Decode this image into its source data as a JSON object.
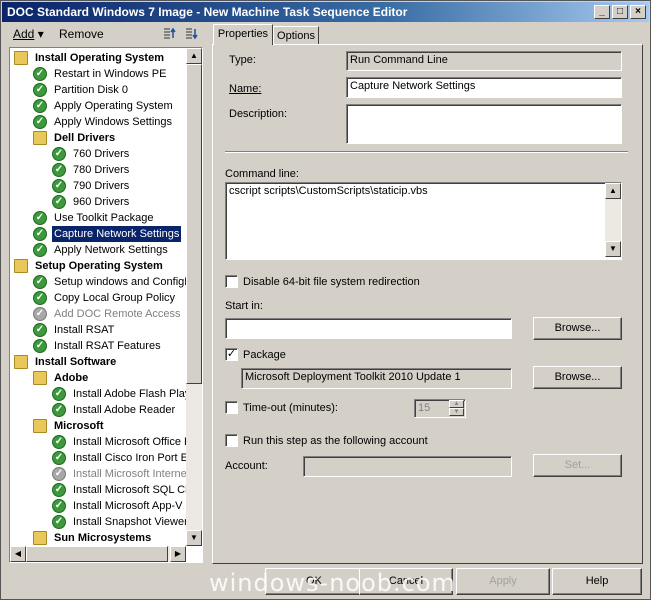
{
  "window": {
    "title": "DOC Standard Windows 7 Image - New Machine Task Sequence Editor",
    "min": "_",
    "max": "□",
    "close": "×"
  },
  "toolbar": {
    "add_label": "Add",
    "add_arrow": "▾",
    "remove_label": "Remove"
  },
  "tree": {
    "nodes": [
      {
        "label": "Install Operating System",
        "type": "group"
      },
      {
        "label": "Restart in Windows PE",
        "type": "step"
      },
      {
        "label": "Partition Disk 0",
        "type": "step"
      },
      {
        "label": "Apply Operating System",
        "type": "step"
      },
      {
        "label": "Apply Windows Settings",
        "type": "step"
      },
      {
        "label": "Dell Drivers",
        "type": "group"
      },
      {
        "label": "760 Drivers",
        "type": "step"
      },
      {
        "label": "780 Drivers",
        "type": "step"
      },
      {
        "label": "790 Drivers",
        "type": "step"
      },
      {
        "label": "960 Drivers",
        "type": "step"
      },
      {
        "label": "Use Toolkit Package",
        "type": "step"
      },
      {
        "label": "Capture Network Settings",
        "type": "step",
        "selected": true
      },
      {
        "label": "Apply Network Settings",
        "type": "step"
      },
      {
        "label": "Setup Operating System",
        "type": "group"
      },
      {
        "label": "Setup windows and ConfigM",
        "type": "step"
      },
      {
        "label": "Copy Local Group Policy",
        "type": "step"
      },
      {
        "label": "Add DOC Remote Access",
        "type": "step",
        "disabled": true
      },
      {
        "label": "Install RSAT",
        "type": "step"
      },
      {
        "label": "Install RSAT Features",
        "type": "step"
      },
      {
        "label": "Install Software",
        "type": "group"
      },
      {
        "label": "Adobe",
        "type": "group"
      },
      {
        "label": "Install Adobe Flash Play",
        "type": "step"
      },
      {
        "label": "Install Adobe Reader",
        "type": "step"
      },
      {
        "label": "Microsoft",
        "type": "group"
      },
      {
        "label": "Install Microsoft Office P",
        "type": "step"
      },
      {
        "label": "Install Cisco Iron Port Er",
        "type": "step"
      },
      {
        "label": "Install Microsoft Interne",
        "type": "step",
        "disabled": true
      },
      {
        "label": "Install Microsoft SQL Cli",
        "type": "step"
      },
      {
        "label": "Install Microsoft App-V C",
        "type": "step"
      },
      {
        "label": "Install Snapshot Viewer",
        "type": "step"
      },
      {
        "label": "Sun Microsystems",
        "type": "group"
      }
    ]
  },
  "tabs": [
    {
      "label": "Properties"
    },
    {
      "label": "Options"
    }
  ],
  "props": {
    "type_label": "Type:",
    "type_value": "Run Command Line",
    "name_label": "Name:",
    "name_value": "Capture Network Settings",
    "description_label": "Description:",
    "description_value": "",
    "command_label": "Command line:",
    "command_value": "cscript scripts\\CustomScripts\\staticip.vbs",
    "disable64_label": "Disable 64-bit file system redirection",
    "startin_label": "Start in:",
    "startin_value": "",
    "browse_label": "Browse...",
    "package_label": "Package",
    "package_value": "Microsoft Deployment Toolkit 2010 Update 1",
    "timeout_label": "Time-out (minutes):",
    "timeout_value": "15",
    "runas_label": "Run this step as the following account",
    "account_label": "Account:",
    "account_value": "",
    "set_label": "Set..."
  },
  "footer": {
    "ok": "OK",
    "cancel": "Cancel",
    "apply": "Apply",
    "help": "Help",
    "watermark": "windows-noob.com"
  }
}
